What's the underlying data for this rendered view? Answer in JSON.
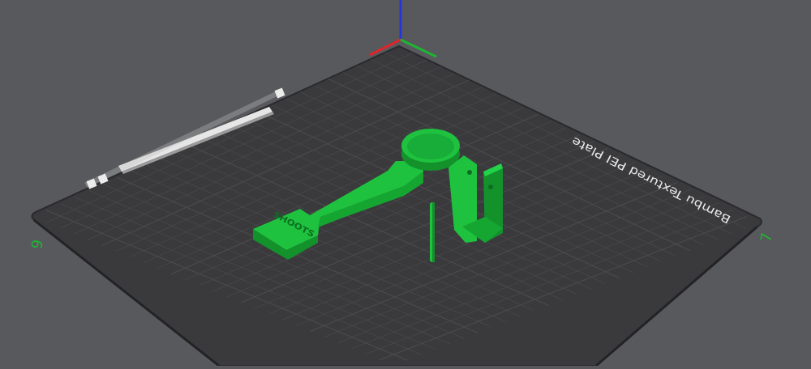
{
  "viewport": {
    "background_color": "#58595c"
  },
  "build_plate": {
    "label": "Bambu Textured PEI Plate",
    "corner_index_left": "6",
    "corner_index_right": "7",
    "plate_color": "#3a3a3c",
    "grid_color": "#4a4a4d",
    "edge_color": "#2a2a2c"
  },
  "model": {
    "embossed_text": "SHOOTS",
    "color": "#1ec23e",
    "shade_color": "#13922c",
    "dark_color": "#0d6e21"
  },
  "axes": {
    "x_color": "#e0242b",
    "y_color": "#1eb534",
    "z_color": "#2337d8"
  },
  "icons": [
    "plate-lock-icon",
    "plate-settings-icon",
    "plate-close-icon"
  ]
}
